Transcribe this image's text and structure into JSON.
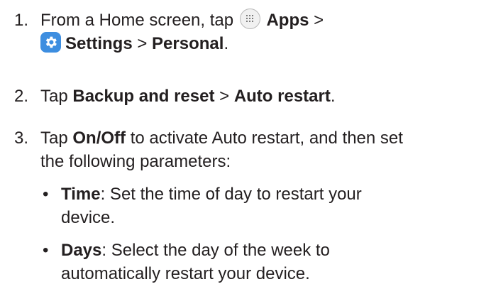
{
  "steps": [
    {
      "number": "1.",
      "prefix": "From a Home screen, tap",
      "apps_icon": "apps-grid-icon",
      "apps_label": "Apps",
      "separator_1": ">",
      "settings_icon": "settings-gear-icon",
      "settings_label": "Settings",
      "separator_2": ">",
      "personal_label": "Personal",
      "period": "."
    },
    {
      "number": "2.",
      "prefix": "Tap",
      "backup_label": "Backup and reset",
      "separator": ">",
      "auto_restart_label": "Auto restart",
      "period": "."
    },
    {
      "number": "3.",
      "prefix": "Tap",
      "onoff_label": "On/Off",
      "line1_rest": "to activate Auto restart, and then set",
      "line2": "the following parameters:"
    }
  ],
  "bullets": [
    {
      "marker": "•",
      "term": "Time",
      "line1": ": Set the time of day to restart your",
      "line2": "device."
    },
    {
      "marker": "•",
      "term": "Days",
      "line1": ": Select the day of the week to",
      "line2": "automatically restart your device."
    }
  ],
  "colors": {
    "text": "#231f20",
    "settings_icon_bg": "#3d8ee0"
  }
}
